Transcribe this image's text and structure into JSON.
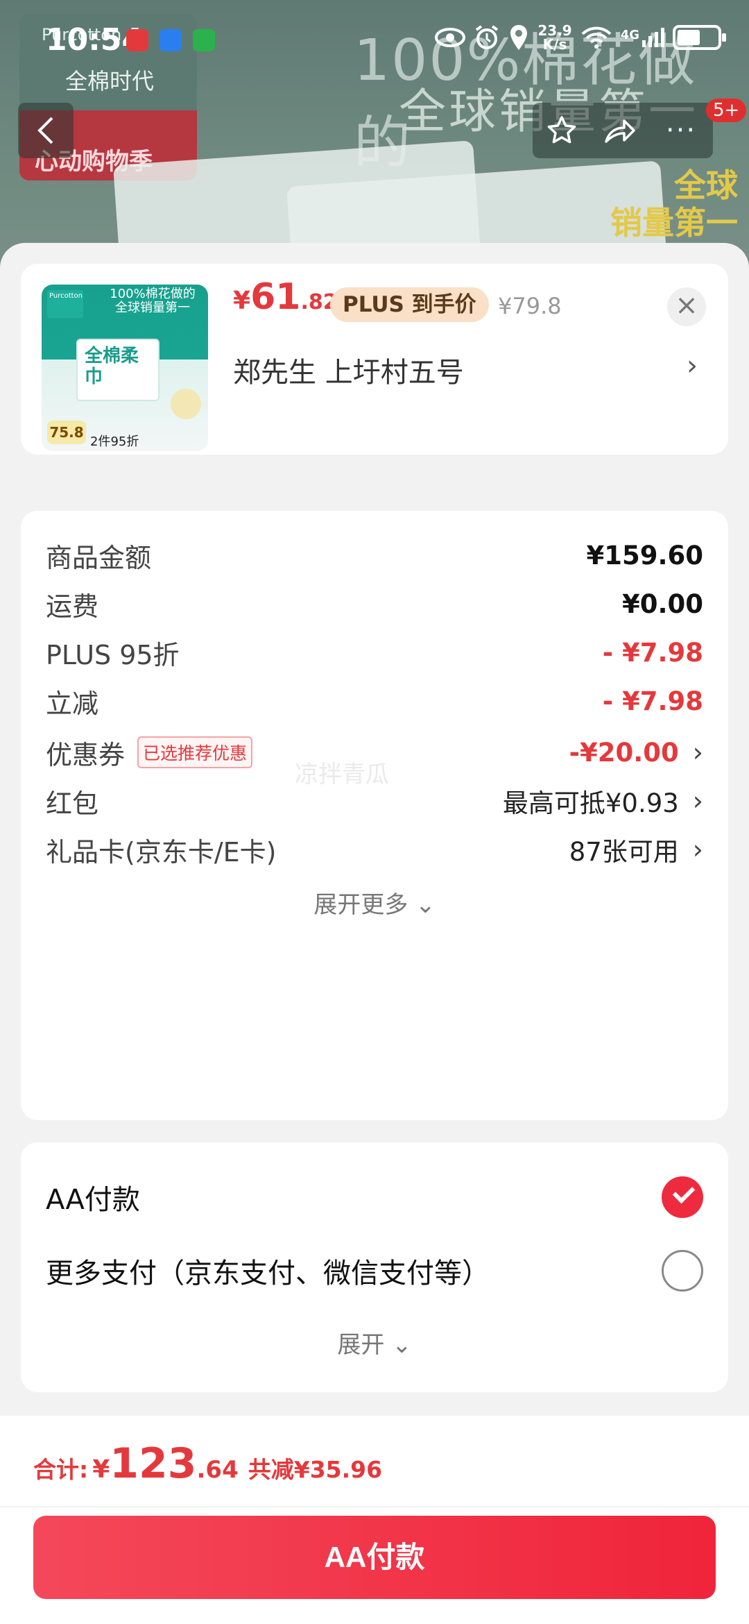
{
  "status_bar": {
    "time": "10:54",
    "net_speed_value": "23.9",
    "net_speed_unit": "K/s",
    "network": "4G"
  },
  "banner": {
    "brand": "全棉时代",
    "event": "心动购物季",
    "headline_1": "100%棉花做的",
    "headline_2": "全球销量第一",
    "badge_line_1": "全球",
    "badge_line_2": "销量第一",
    "more_label": "···",
    "more_badge": "5+"
  },
  "product": {
    "thumb_brand": "Purcotton",
    "thumb_headline": "100%棉花做的 全球销量第一",
    "thumb_box_text": "全棉柔巾",
    "thumb_price": "75.8",
    "thumb_deal": "2件95折",
    "price_currency": "¥",
    "price_integer": "61",
    "price_decimal": ".82",
    "plus_tag": "PLUS 到手价",
    "original_price": "¥79.8",
    "close_icon": "×",
    "address": "郑先生  上圩村五号",
    "address_arrow": "›"
  },
  "amounts": {
    "rows": [
      {
        "label": "商品金额",
        "value": "¥159.60"
      },
      {
        "label": "运费",
        "value": "¥0.00"
      },
      {
        "label": "PLUS 95折",
        "value": "- ¥7.98"
      },
      {
        "label": "立减",
        "value": "- ¥7.98"
      },
      {
        "label": "优惠券",
        "value": "-¥20.00",
        "tag": "已选推荐优惠"
      },
      {
        "label": "红包",
        "value": "最高可抵¥0.93"
      },
      {
        "label": "礼品卡(京东卡/E卡)",
        "value": "87张可用"
      }
    ],
    "watermark": "凉拌青瓜",
    "expand_more": "展开更多 ⌄"
  },
  "payment": {
    "options": [
      {
        "label": "AA付款",
        "checked": true
      },
      {
        "label": "更多支付（京东支付、微信支付等）",
        "checked": false
      }
    ],
    "expand": "展开 ⌄"
  },
  "bottom": {
    "total_label": "合计:",
    "total_currency": "¥",
    "total_integer": "123",
    "total_decimal": ".64",
    "total_saved": "共减¥35.96",
    "pay_button": "AA付款"
  },
  "colors": {
    "accent_red": "#e4393c",
    "pay_button": "#f0243a",
    "checked_radio": "#ee2a3e"
  }
}
